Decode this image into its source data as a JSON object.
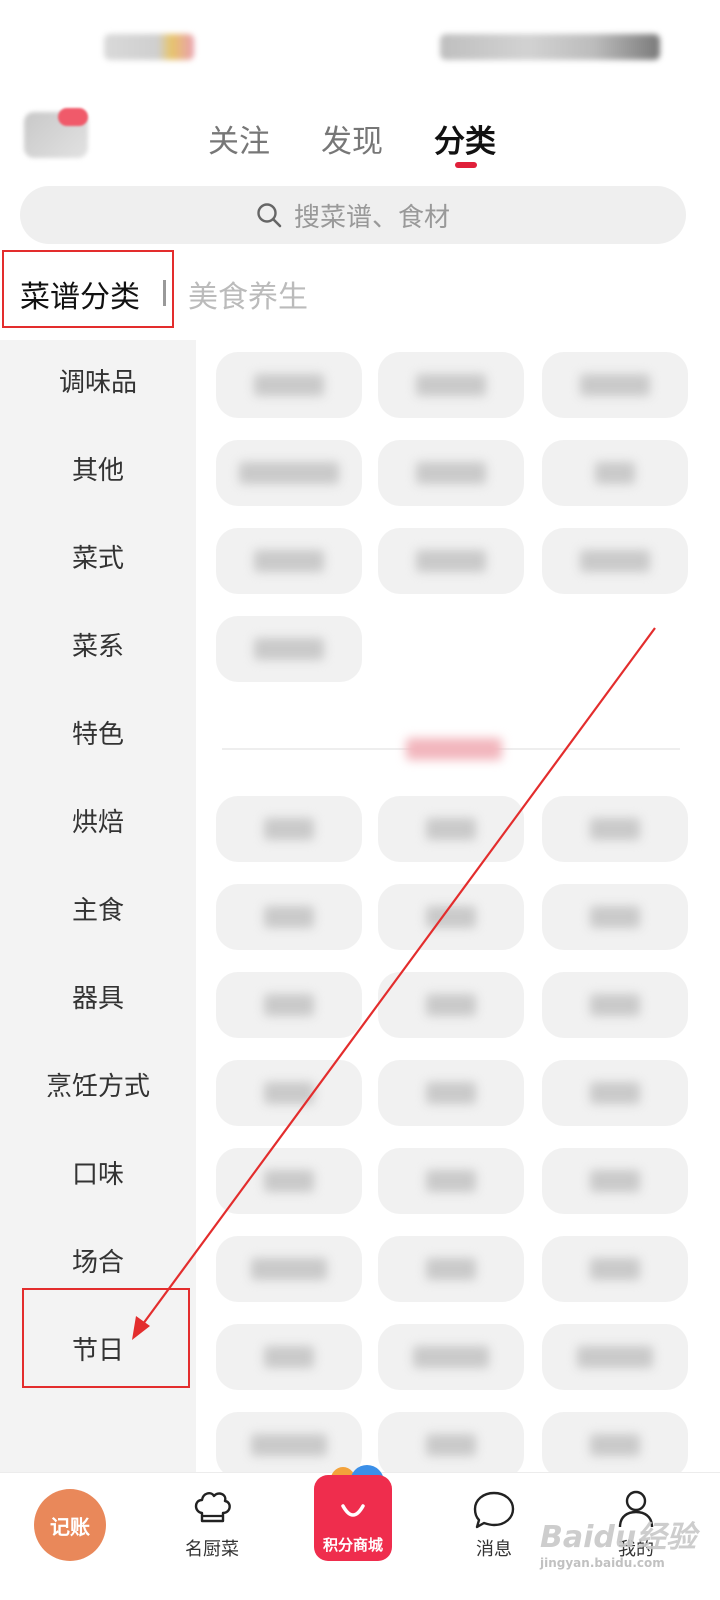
{
  "top_nav": {
    "tabs": [
      {
        "label": "关注"
      },
      {
        "label": "发现"
      },
      {
        "label": "分类"
      }
    ],
    "active_tab": "分类",
    "accent_color": "#e0203a"
  },
  "search": {
    "placeholder": "搜菜谱、食材"
  },
  "category_tabs": {
    "active": "菜谱分类",
    "inactive": "美食养生"
  },
  "sidebar": {
    "items": [
      {
        "label": "调味品"
      },
      {
        "label": "其他"
      },
      {
        "label": "菜式"
      },
      {
        "label": "菜系"
      },
      {
        "label": "特色"
      },
      {
        "label": "烘焙"
      },
      {
        "label": "主食"
      },
      {
        "label": "器具"
      },
      {
        "label": "烹饪方式"
      },
      {
        "label": "口味"
      },
      {
        "label": "场合"
      },
      {
        "label": "节日"
      }
    ]
  },
  "bottom_nav": {
    "items": [
      {
        "label": "记账",
        "icon": "ledger-icon"
      },
      {
        "label": "名厨菜",
        "icon": "chef-hat-icon"
      },
      {
        "label": "积分商城",
        "icon": "shopping-bag-icon"
      },
      {
        "label": "消息",
        "icon": "chat-bubble-icon"
      },
      {
        "label": "我的",
        "icon": "user-icon"
      }
    ]
  },
  "watermark": {
    "text": "Baidu经验",
    "subtext": "jingyan.baidu.com"
  },
  "annotation_color": "#e32d2d"
}
